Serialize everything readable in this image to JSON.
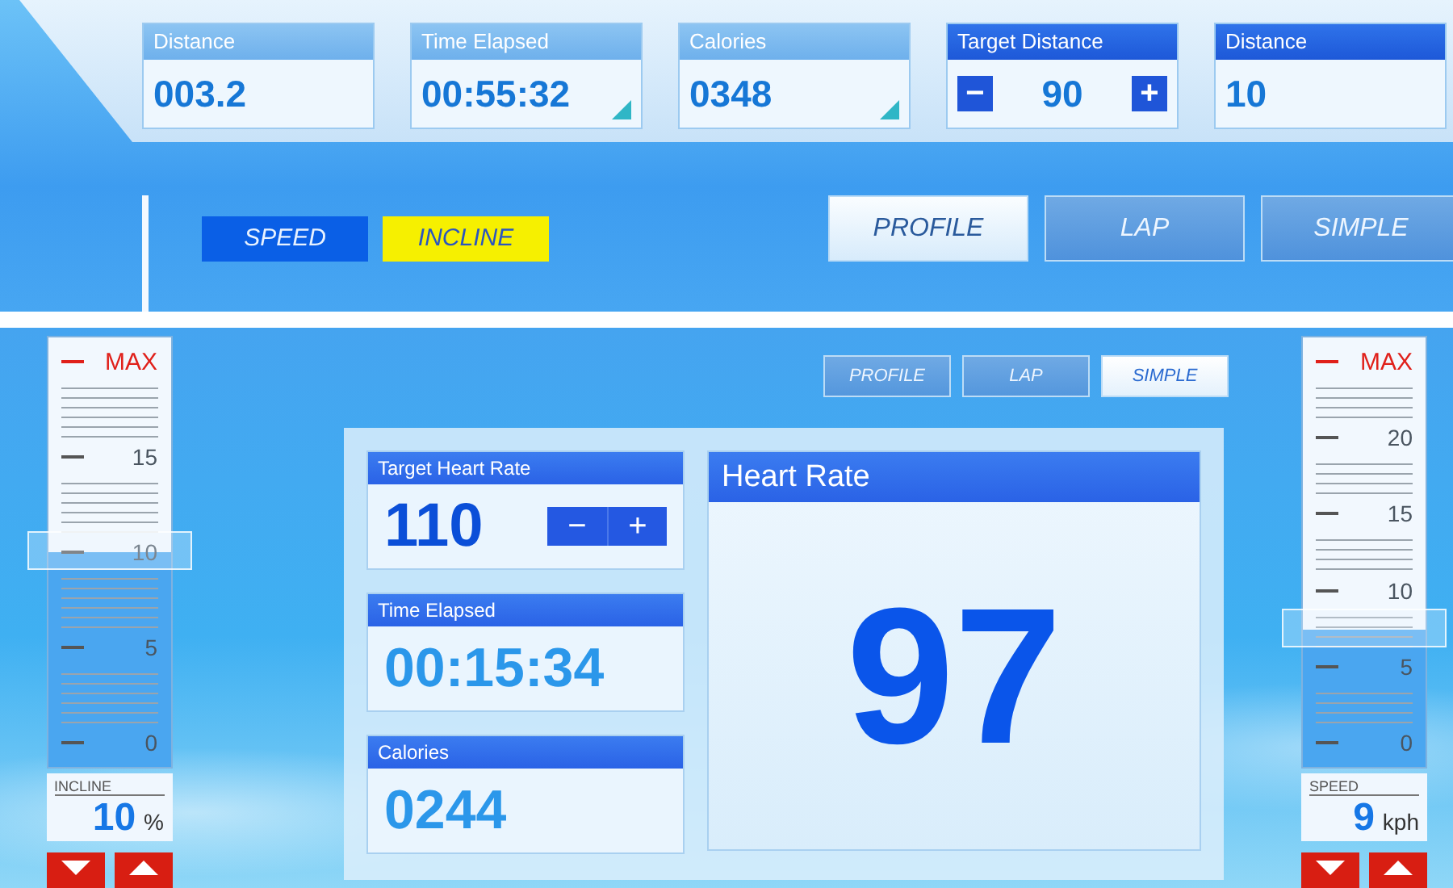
{
  "top_screen": {
    "stats": [
      {
        "label": "Distance",
        "value": "003.2",
        "kind": "plain",
        "highlighted": false,
        "corner": false
      },
      {
        "label": "Time Elapsed",
        "value": "00:55:32",
        "kind": "plain",
        "highlighted": false,
        "corner": true
      },
      {
        "label": "Calories",
        "value": "0348",
        "kind": "plain",
        "highlighted": false,
        "corner": true
      },
      {
        "label": "Target Distance",
        "value": "90",
        "kind": "stepper",
        "highlighted": true,
        "corner": false,
        "decrease": "−",
        "increase": "+"
      },
      {
        "label": "Distance",
        "value": "10",
        "kind": "plain",
        "highlighted": true,
        "corner": false
      }
    ],
    "legend": [
      {
        "label": "SPEED",
        "color": "#0a5fe6"
      },
      {
        "label": "INCLINE",
        "color": "#f6f000"
      }
    ],
    "modes": [
      {
        "label": "PROFILE",
        "selected": true
      },
      {
        "label": "LAP",
        "selected": false
      },
      {
        "label": "SIMPLE",
        "selected": false
      }
    ]
  },
  "bottom_screen": {
    "incline_slider": {
      "scale": [
        "MAX",
        "15",
        "10",
        "5",
        "0"
      ],
      "level": 0.5,
      "readout_label": "INCLINE",
      "value": "10",
      "unit": "%"
    },
    "modes": [
      {
        "label": "PROFILE",
        "selected": false
      },
      {
        "label": "LAP",
        "selected": false
      },
      {
        "label": "SIMPLE",
        "selected": true
      }
    ],
    "target_heart_rate": {
      "label": "Target Heart Rate",
      "value": "110",
      "decrease": "−",
      "increase": "+"
    },
    "time_elapsed": {
      "label": "Time Elapsed",
      "value": "00:15:34"
    },
    "calories": {
      "label": "Calories",
      "value": "0244"
    },
    "heart_rate": {
      "label": "Heart Rate",
      "value": "97"
    },
    "speed_slider": {
      "scale": [
        "MAX",
        "20",
        "15",
        "10",
        "5",
        "0"
      ],
      "level": 0.32,
      "readout_label": "SPEED",
      "value": "9",
      "unit": "kph"
    }
  }
}
